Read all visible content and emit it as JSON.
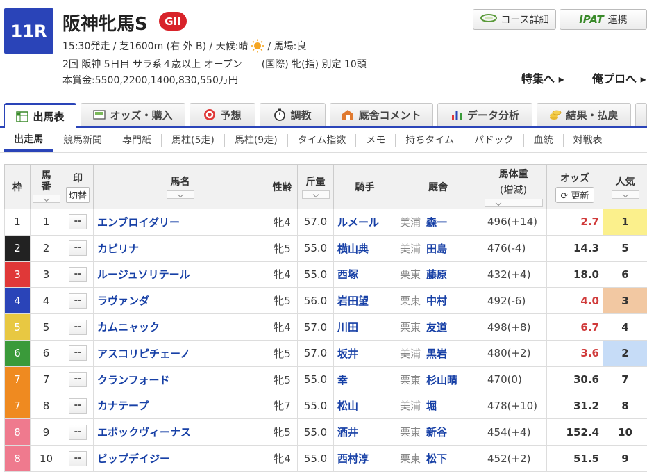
{
  "race": {
    "number": "11R",
    "name": "阪神牝馬S",
    "grade": "GII",
    "info_pre": "15:30発走 / 芝1600m (右 外 B) / 天候:晴",
    "info_post": "/ 馬場:良",
    "condition": "2回 阪神 5日目 サラ系４歳以上 オープン　　(国際) 牝(指) 別定 10頭",
    "prize": "本賞金:5500,2200,1400,830,550万円"
  },
  "header_buttons": {
    "course": "コース詳細",
    "ipat_logo": "IPAT",
    "ipat_label": "連携",
    "feature": "特集へ ▸",
    "myprof": "俺プロへ ▸"
  },
  "main_tabs": [
    {
      "label": "出馬表",
      "icon": "table-icon"
    },
    {
      "label": "オッズ・購入",
      "icon": "ipat-icon"
    },
    {
      "label": "予想",
      "icon": "target-icon"
    },
    {
      "label": "調教",
      "icon": "stopwatch-icon"
    },
    {
      "label": "厩舎コメント",
      "icon": "stable-icon"
    },
    {
      "label": "データ分析",
      "icon": "bar-chart-icon"
    },
    {
      "label": "結果・払戻",
      "icon": "coins-icon"
    }
  ],
  "sub_tabs": [
    "出走馬",
    "競馬新聞",
    "専門紙",
    "馬柱(5走)",
    "馬柱(9走)",
    "タイム指数",
    "メモ",
    "持ちタイム",
    "パドック",
    "血統",
    "対戦表"
  ],
  "table": {
    "headers": {
      "waku": "枠",
      "umaban": "馬番",
      "mark": "印",
      "mark_switch": "切替",
      "horse": "馬名",
      "sexage": "性齢",
      "weight": "斤量",
      "jockey": "騎手",
      "trainer": "厩舎",
      "bodyweight": "馬体重",
      "bodyweight_sub": "(増減)",
      "odds": "オッズ",
      "odds_refresh": "更新",
      "pop": "人気"
    },
    "mark_placeholder": "--",
    "rows": [
      {
        "waku": "1",
        "umaban": "1",
        "horse": "エンブロイダリー",
        "sexage": "牝4",
        "weight": "57.0",
        "jockey": "ルメール",
        "region": "美浦",
        "trainer": "森一",
        "bodyweight": "496(+14)",
        "odds": "2.7",
        "pop": "1"
      },
      {
        "waku": "2",
        "umaban": "2",
        "horse": "カピリナ",
        "sexage": "牝5",
        "weight": "55.0",
        "jockey": "横山典",
        "region": "美浦",
        "trainer": "田島",
        "bodyweight": "476(-4)",
        "odds": "14.3",
        "pop": "5"
      },
      {
        "waku": "3",
        "umaban": "3",
        "horse": "ルージュソリテール",
        "sexage": "牝4",
        "weight": "55.0",
        "jockey": "西塚",
        "region": "栗東",
        "trainer": "藤原",
        "bodyweight": "432(+4)",
        "odds": "18.0",
        "pop": "6"
      },
      {
        "waku": "4",
        "umaban": "4",
        "horse": "ラヴァンダ",
        "sexage": "牝5",
        "weight": "56.0",
        "jockey": "岩田望",
        "region": "栗東",
        "trainer": "中村",
        "bodyweight": "492(-6)",
        "odds": "4.0",
        "pop": "3"
      },
      {
        "waku": "5",
        "umaban": "5",
        "horse": "カムニャック",
        "sexage": "牝4",
        "weight": "57.0",
        "jockey": "川田",
        "region": "栗東",
        "trainer": "友道",
        "bodyweight": "498(+8)",
        "odds": "6.7",
        "pop": "4"
      },
      {
        "waku": "6",
        "umaban": "6",
        "horse": "アスコリピチェーノ",
        "sexage": "牝5",
        "weight": "57.0",
        "jockey": "坂井",
        "region": "美浦",
        "trainer": "黒岩",
        "bodyweight": "480(+2)",
        "odds": "3.6",
        "pop": "2"
      },
      {
        "waku": "7",
        "umaban": "7",
        "horse": "クランフォード",
        "sexage": "牝5",
        "weight": "55.0",
        "jockey": "幸",
        "region": "栗東",
        "trainer": "杉山晴",
        "bodyweight": "470(0)",
        "odds": "30.6",
        "pop": "7"
      },
      {
        "waku": "7",
        "umaban": "8",
        "horse": "カナテープ",
        "sexage": "牝7",
        "weight": "55.0",
        "jockey": "松山",
        "region": "美浦",
        "trainer": "堀",
        "bodyweight": "478(+10)",
        "odds": "31.2",
        "pop": "8"
      },
      {
        "waku": "8",
        "umaban": "9",
        "horse": "エポックヴィーナス",
        "sexage": "牝5",
        "weight": "55.0",
        "jockey": "酒井",
        "region": "栗東",
        "trainer": "新谷",
        "bodyweight": "454(+4)",
        "odds": "152.4",
        "pop": "10"
      },
      {
        "waku": "8",
        "umaban": "10",
        "horse": "ビップデイジー",
        "sexage": "牝4",
        "weight": "55.0",
        "jockey": "西村淳",
        "region": "栗東",
        "trainer": "松下",
        "bodyweight": "452(+2)",
        "odds": "51.5",
        "pop": "9"
      }
    ]
  },
  "colors": {
    "accent": "#2a44b8",
    "grade": "#d8232a",
    "link": "#1740a6",
    "hot_odds": "#d03a3a"
  }
}
